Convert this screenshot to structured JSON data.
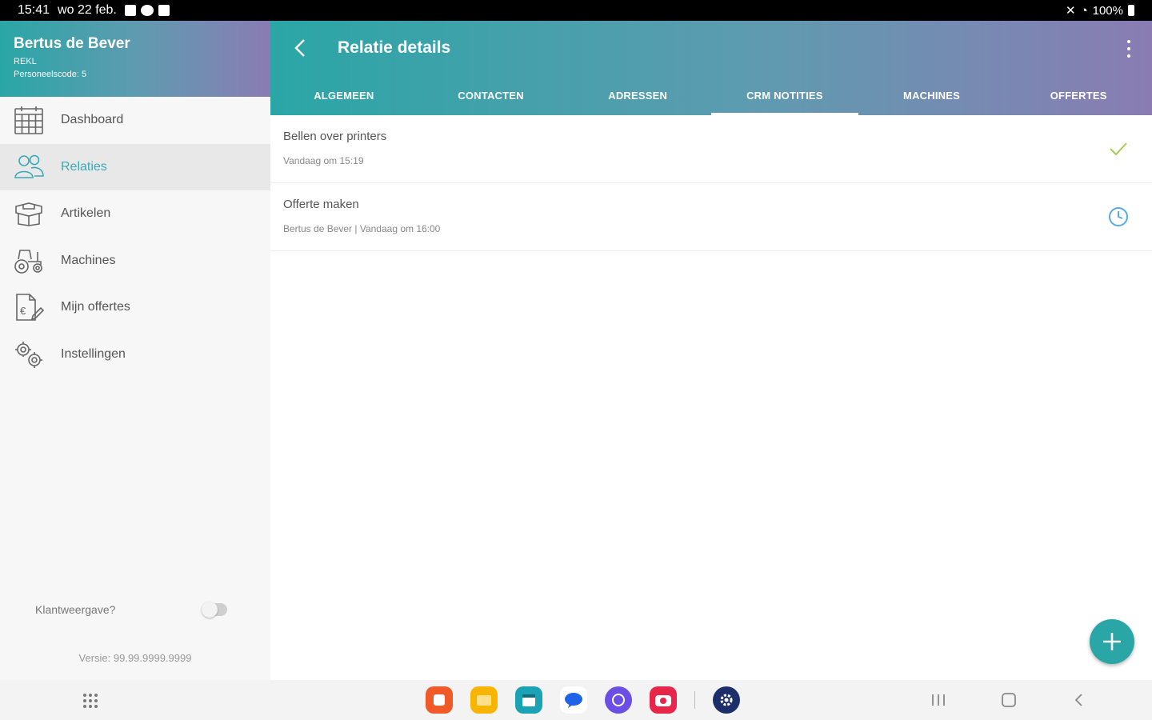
{
  "status_bar": {
    "time": "15:41",
    "date": "wo 22 feb.",
    "battery": "100%"
  },
  "sidebar": {
    "user_name": "Bertus de Bever",
    "user_sub": "REKL",
    "employee_code": "Personeelscode: 5",
    "items": [
      {
        "label": "Dashboard",
        "icon": "calendar-icon"
      },
      {
        "label": "Relaties",
        "icon": "users-icon"
      },
      {
        "label": "Artikelen",
        "icon": "box-icon"
      },
      {
        "label": "Machines",
        "icon": "tractor-icon"
      },
      {
        "label": "Mijn offertes",
        "icon": "quote-document-icon"
      },
      {
        "label": "Instellingen",
        "icon": "gears-icon"
      }
    ],
    "active_item": "Relaties",
    "customer_view_label": "Klantweergave?",
    "customer_view_enabled": false,
    "version": "Versie: 99.99.9999.9999"
  },
  "header": {
    "title": "Relatie details",
    "tabs": [
      "ALGEMEEN",
      "CONTACTEN",
      "ADRESSEN",
      "CRM NOTITIES",
      "MACHINES",
      "OFFERTES"
    ],
    "active_tab": "CRM NOTITIES"
  },
  "notes": [
    {
      "title": "Bellen over printers",
      "subtitle": "Vandaag om 15:19",
      "status": "done",
      "status_icon": "check-icon"
    },
    {
      "title": "Offerte maken",
      "subtitle": "Bertus de Bever | Vandaag om 16:00",
      "status": "scheduled",
      "status_icon": "clock-icon"
    }
  ],
  "colors": {
    "accent": "#2aa6a6",
    "gradient_end": "#8a7cb3",
    "active_text": "#3aa9b5",
    "check": "#a5c95a",
    "clock": "#5aa9e6"
  }
}
